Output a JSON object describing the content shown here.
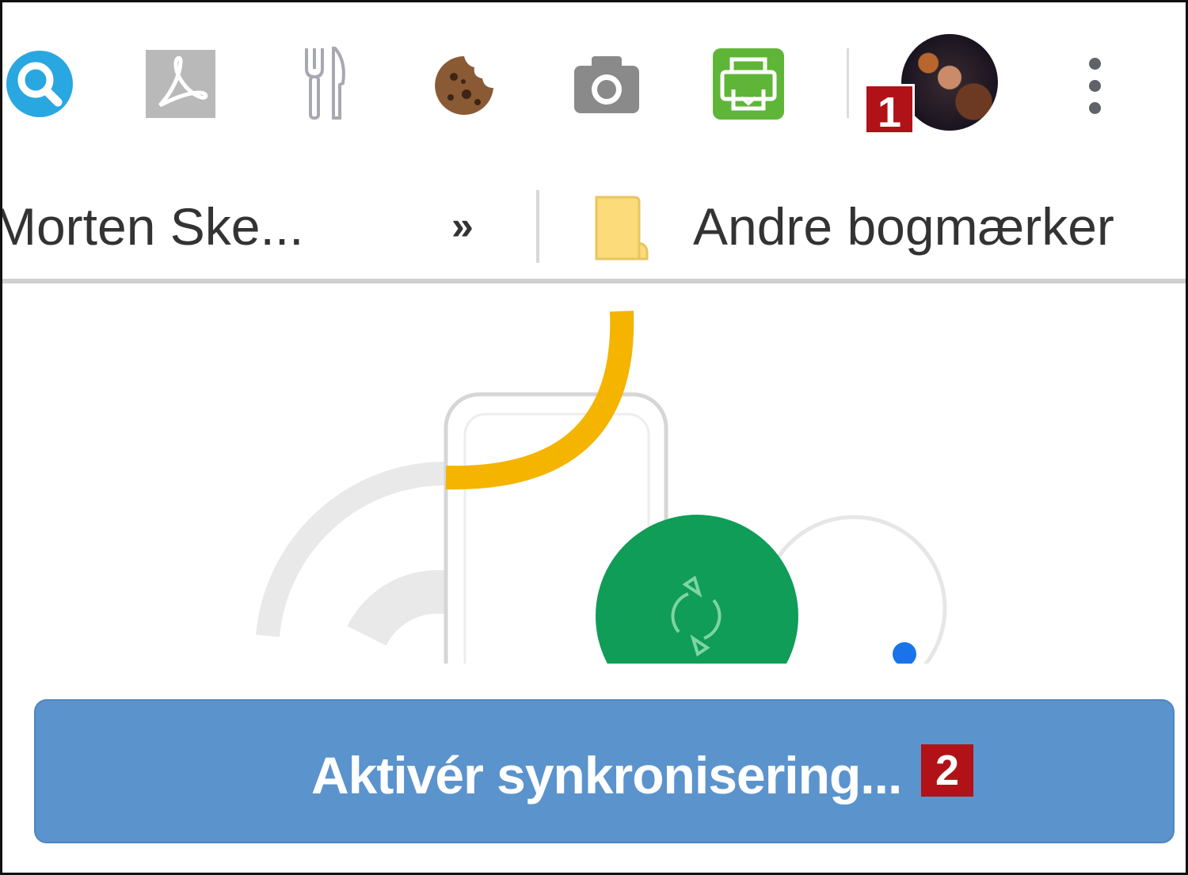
{
  "toolbar": {
    "extensions": [
      {
        "name": "search-extension",
        "icon": "magnifier-icon",
        "color": "#29a7e1"
      },
      {
        "name": "pdf-extension",
        "icon": "acrobat-pdf-icon",
        "color": "#b5b5b5"
      },
      {
        "name": "recipe-extension",
        "icon": "fork-knife-icon",
        "color": "#a8a8b0"
      },
      {
        "name": "cookie-extension",
        "icon": "cookie-icon",
        "color": "#7a4a2a"
      },
      {
        "name": "screenshot-extension",
        "icon": "camera-icon",
        "color": "#8c8c8c"
      },
      {
        "name": "print-extension",
        "icon": "printer-icon",
        "color": "#5fb538"
      }
    ],
    "avatar": {
      "name": "profile-avatar"
    },
    "callouts": {
      "profile": "1",
      "sync": "2"
    },
    "menu_icon": "vertical-dots-icon"
  },
  "bookmarks": {
    "item_label": "Morten Ske...",
    "overflow_label": "»",
    "other_bookmarks_label": "Andre bogmærker",
    "folder_color": "#fbdb7a"
  },
  "illustration": {
    "accent_yellow": "#f4b400",
    "accent_green": "#0f9d58",
    "accent_blue": "#1a73e8",
    "sync_icon": "sync-arrows-icon"
  },
  "sync": {
    "button_label": "Aktivér synkronisering...",
    "button_color": "#5b93cd"
  }
}
